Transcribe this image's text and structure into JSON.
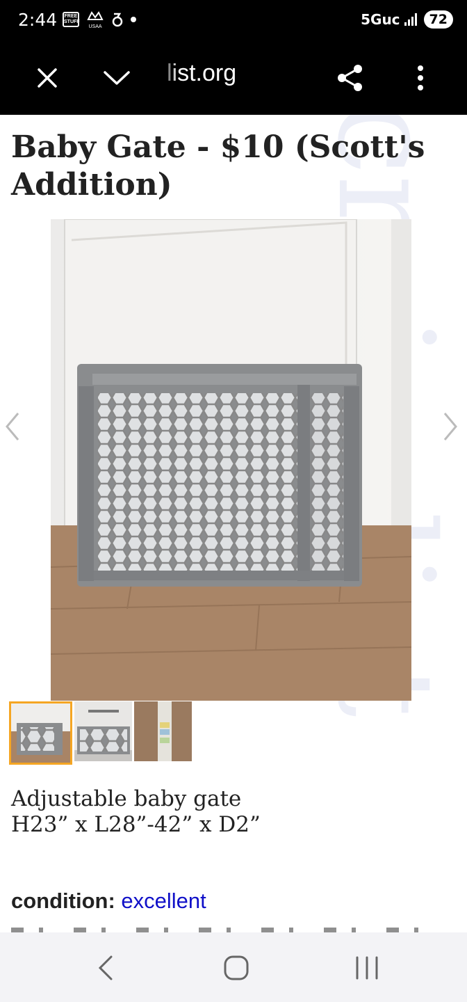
{
  "status_bar": {
    "time": "2:44",
    "badge_free": "FREE",
    "badge_stuff": "STUFF",
    "badge_usaa": "USAA",
    "network": "5Guc",
    "battery": "72"
  },
  "toolbar": {
    "url": "list.org"
  },
  "post": {
    "title": "Baby Gate - $10 (Scott's Addition)",
    "body_line1": "Adjustable baby gate",
    "body_line2": "H23” x L28”-42” x D2”",
    "condition_label": "condition:",
    "condition_value": "excellent"
  },
  "watermark": "craigslist",
  "colors": {
    "accent_thumb_border": "#f5a623",
    "link_blue": "#1010c8",
    "bar_black": "#000000",
    "nav_bg": "#f3f3f6"
  },
  "icons": {
    "close": "close-icon",
    "collapse": "chevron-down-icon",
    "share": "share-icon",
    "more": "more-vertical-icon",
    "prev": "chevron-left-icon",
    "next": "chevron-right-icon",
    "back": "back-icon",
    "home": "home-icon",
    "recents": "recents-icon"
  }
}
